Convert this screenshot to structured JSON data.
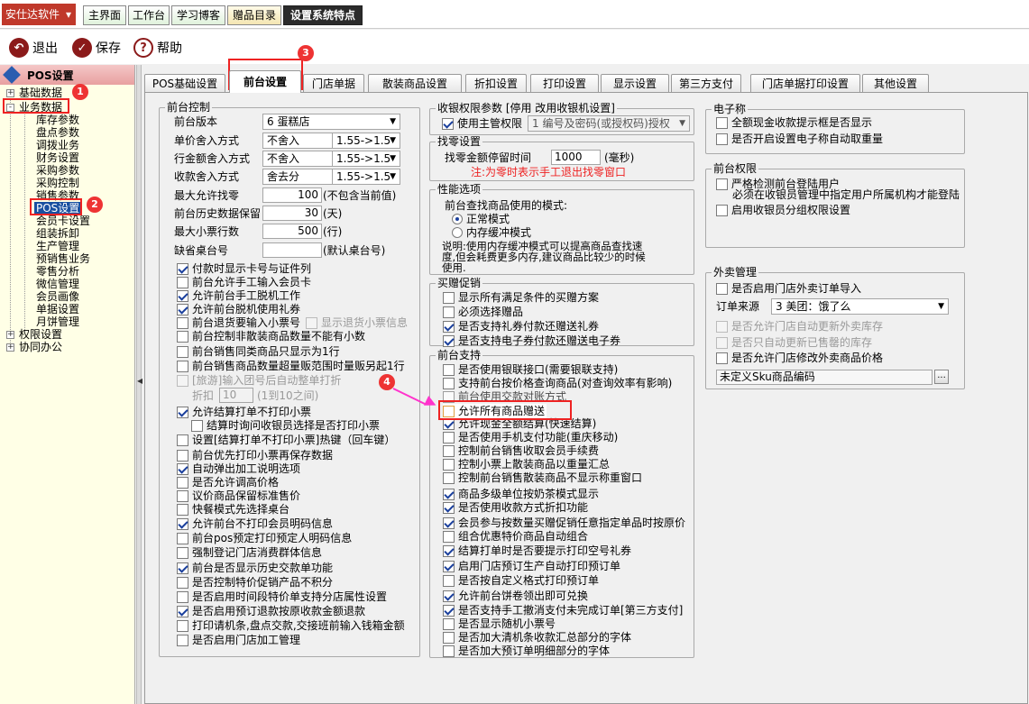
{
  "app": {
    "menu_label": "安仕达软件",
    "caret": "▾"
  },
  "top_tabs": [
    "主界面",
    "工作台",
    "学习博客",
    "赠品目录",
    "设置系统特点"
  ],
  "toolbar": {
    "exit": "退出",
    "save": "保存",
    "help": "帮助",
    "help_glyph": "?"
  },
  "sidebar": {
    "title": "POS设置",
    "groups": {
      "basic": "基础数据",
      "business": "业务数据",
      "rights": "权限设置",
      "collab": "协同办公"
    },
    "items": [
      "库存参数",
      "盘点参数",
      "调拨业务",
      "财务设置",
      "采购参数",
      "采购控制",
      "销售参数",
      "POS设置",
      "会员卡设置",
      "组装拆卸",
      "生产管理",
      "预销售业务",
      "零售分析",
      "微信管理",
      "会员画像",
      "单据设置",
      "月饼管理"
    ],
    "pm": {
      "plus": "+",
      "minus": "-"
    },
    "collapse_arrow": "◀"
  },
  "badges": [
    "1",
    "2",
    "3",
    "4"
  ],
  "tabs": [
    "POS基础设置",
    "前台设置",
    "门店单据",
    "散装商品设置",
    "折扣设置",
    "打印设置",
    "显示设置",
    "第三方支付",
    "门店单据打印设置",
    "其他设置"
  ],
  "front_control": {
    "title": "前台控制",
    "version": {
      "label": "前台版本",
      "value": "6 蛋糕店"
    },
    "price_round": {
      "label": "单价舍入方式",
      "value": "不舍入",
      "option": "1.55->1.5"
    },
    "amount_round": {
      "label": "行金额舍入方式",
      "value": "不舍入",
      "option": "1.55->1.5"
    },
    "receipt_round": {
      "label": "收款舍入方式",
      "value": "舍去分",
      "option": "1.55->1.5"
    },
    "max_change": {
      "label": "最大允许找零",
      "value": "100",
      "unit": "(不包含当前值)"
    },
    "history_keep": {
      "label": "前台历史数据保留",
      "value": "30",
      "unit": "(天)"
    },
    "max_receipt_rows": {
      "label": "最大小票行数",
      "value": "500",
      "unit": "(行)"
    },
    "missing_table": {
      "label": "缺省桌台号",
      "unit": "(默认桌台号)"
    },
    "discount": {
      "label": "折扣",
      "value": "10",
      "unit": "(1到10之间)"
    },
    "checks": [
      {
        "label": "付款时显示卡号与证件列",
        "on": true
      },
      {
        "label": "前台允许手工输入会员卡",
        "on": false
      },
      {
        "label": "允许前台手工脱机工作",
        "on": true
      },
      {
        "label": "允许前台脱机使用礼券",
        "on": true
      },
      {
        "label": "前台退货要输入小票号",
        "on": false
      },
      {
        "label": "前台控制非散装商品数量不能有小数",
        "on": false
      },
      {
        "label": "前台销售同类商品只显示为1行",
        "on": false
      },
      {
        "label": "前台销售商品数量超量贩范围时量贩另起1行",
        "on": false
      },
      {
        "label": "[旅游]输入团号后自动整单打折",
        "on": false
      },
      {
        "label": "允许结算打单不打印小票",
        "on": true
      },
      {
        "label": "结算时询问收银员选择是否打印小票",
        "on": false
      },
      {
        "label": "设置[结算打单不打印小票]热键（回车键）",
        "on": false
      },
      {
        "label": "前台优先打印小票再保存数据",
        "on": false
      },
      {
        "label": "自动弹出加工说明选项",
        "on": true
      },
      {
        "label": "是否允许调高价格",
        "on": false
      },
      {
        "label": "议价商品保留标准售价",
        "on": false
      },
      {
        "label": "快餐模式先选择桌台",
        "on": false
      },
      {
        "label": "允许前台不打印会员明码信息",
        "on": true
      },
      {
        "label": "前台pos预定打印预定人明码信息",
        "on": false
      },
      {
        "label": "强制登记门店消费群体信息",
        "on": false
      },
      {
        "label": "前台是否显示历史交款单功能",
        "on": true
      },
      {
        "label": "是否控制特价促销产品不积分",
        "on": false
      },
      {
        "label": "是否启用时间段特价单支持分店属性设置",
        "on": false
      },
      {
        "label": "是否启用预订退款按原收款金额退款",
        "on": true
      },
      {
        "label": "打印请机条,盘点交款,交接班前输入钱箱金额",
        "on": false
      },
      {
        "label": "是否启用门店加工管理",
        "on": false
      }
    ],
    "show_return_info": "显示退货小票信息"
  },
  "cashier_rights": {
    "title": "收银权限参数 [停用  改用收银机设置]",
    "check": "使用主管权限",
    "value": "1 编号及密码(或授权码)授权"
  },
  "change_settings": {
    "title": "找零设置",
    "label": "找零金额停留时间",
    "value": "1000",
    "unit": "(毫秒)",
    "note": "注:为零时表示手工退出找零窗口"
  },
  "performance": {
    "title": "性能选项",
    "label": "前台查找商品使用的模式:",
    "opt1": "正常模式",
    "opt2": "内存缓冲模式",
    "desc": "说明:使用内存缓冲模式可以提高商品查找速度,但会耗费更多内存,建议商品比较少的时候使用."
  },
  "promotion": {
    "title": "买赠促销",
    "checks": [
      {
        "label": "显示所有满足条件的买赠方案",
        "on": false
      },
      {
        "label": "必须选择赠品",
        "on": false
      },
      {
        "label": "是否支持礼券付款还赠送礼券",
        "on": true
      },
      {
        "label": "是否支持电子券付款还赠送电子券",
        "on": true
      }
    ]
  },
  "front_support": {
    "title": "前台支持",
    "checks": [
      {
        "label": "是否使用银联接口(需要银联支持)",
        "on": false
      },
      {
        "label": "支持前台按价格查询商品(对查询效率有影响)",
        "on": false
      },
      {
        "label": "前台使用交款对账方式",
        "on": false
      },
      {
        "label": "允许所有商品赠送",
        "on": false
      },
      {
        "label": "允许现金全额结算(快速结算)",
        "on": true
      },
      {
        "label": "是否使用手机支付功能(重庆移动)",
        "on": false
      },
      {
        "label": "控制前台销售收取会员手续费",
        "on": false
      },
      {
        "label": "控制小票上散装商品以重量汇总",
        "on": false
      },
      {
        "label": "控制前台销售散装商品不显示称重窗口",
        "on": false
      },
      {
        "label": "商品多级单位按奶茶模式显示",
        "on": true
      },
      {
        "label": "是否使用收款方式折扣功能",
        "on": true
      },
      {
        "label": "会员参与按数量买赠促销任意指定单品时按原价",
        "on": true
      },
      {
        "label": "组合优惠特价商品自动组合",
        "on": false
      },
      {
        "label": "结算打单时是否要提示打印空号礼券",
        "on": true
      },
      {
        "label": "启用门店预订生产自动打印预订单",
        "on": true
      },
      {
        "label": "是否按自定义格式打印预订单",
        "on": false
      },
      {
        "label": "允许前台饼卷领出即可兑换",
        "on": true
      },
      {
        "label": "是否支持手工撤消支付未完成订单[第三方支付]",
        "on": true
      },
      {
        "label": "是否显示随机小票号",
        "on": false
      },
      {
        "label": "是否加大清机条收款汇总部分的字体",
        "on": false
      },
      {
        "label": "是否加大预订单明细部分的字体",
        "on": false
      }
    ]
  },
  "scale": {
    "title": "电子称",
    "checks": [
      {
        "label": "全额现金收款提示框是否显示",
        "on": false
      },
      {
        "label": "是否开启设置电子称自动取重量",
        "on": false
      }
    ]
  },
  "front_rights": {
    "title": "前台权限",
    "checks": [
      {
        "label": "严格检测前台登陆用户",
        "on": false
      },
      {
        "label": "必须在收银员管理中指定用户所属机构才能登陆"
      },
      {
        "label": "启用收银员分组权限设置",
        "on": false
      }
    ]
  },
  "takeout": {
    "title": "外卖管理",
    "enable": "是否启用门店外卖订单导入",
    "source_label": "订单来源",
    "source_value": "3 美团：饿了么",
    "checks": [
      {
        "label": "是否允许门店自动更新外卖库存",
        "on": false
      },
      {
        "label": "是否只自动更新已售罄的库存",
        "on": false
      },
      {
        "label": "是否允许门店修改外卖商品价格",
        "on": false
      }
    ],
    "sku": "未定义Sku商品编码",
    "ellipsis": "..."
  }
}
